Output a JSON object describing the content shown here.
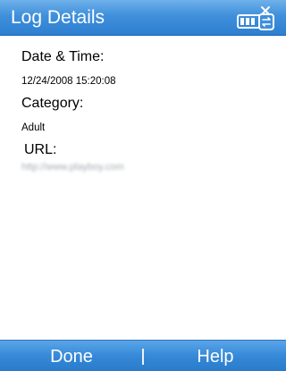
{
  "titlebar": {
    "title": "Log Details"
  },
  "details": {
    "datetime_label": "Date & Time:",
    "datetime_value": "12/24/2008 15:20:08",
    "category_label": "Category:",
    "category_value": "Adult",
    "url_label": "URL:",
    "url_value": "http://www.playboy.com"
  },
  "softkeys": {
    "left": "Done",
    "right": "Help"
  },
  "colors": {
    "bar_blue": "#3f8fdb",
    "text": "#000000"
  },
  "icons": {
    "status": "battery-sync-icon"
  }
}
